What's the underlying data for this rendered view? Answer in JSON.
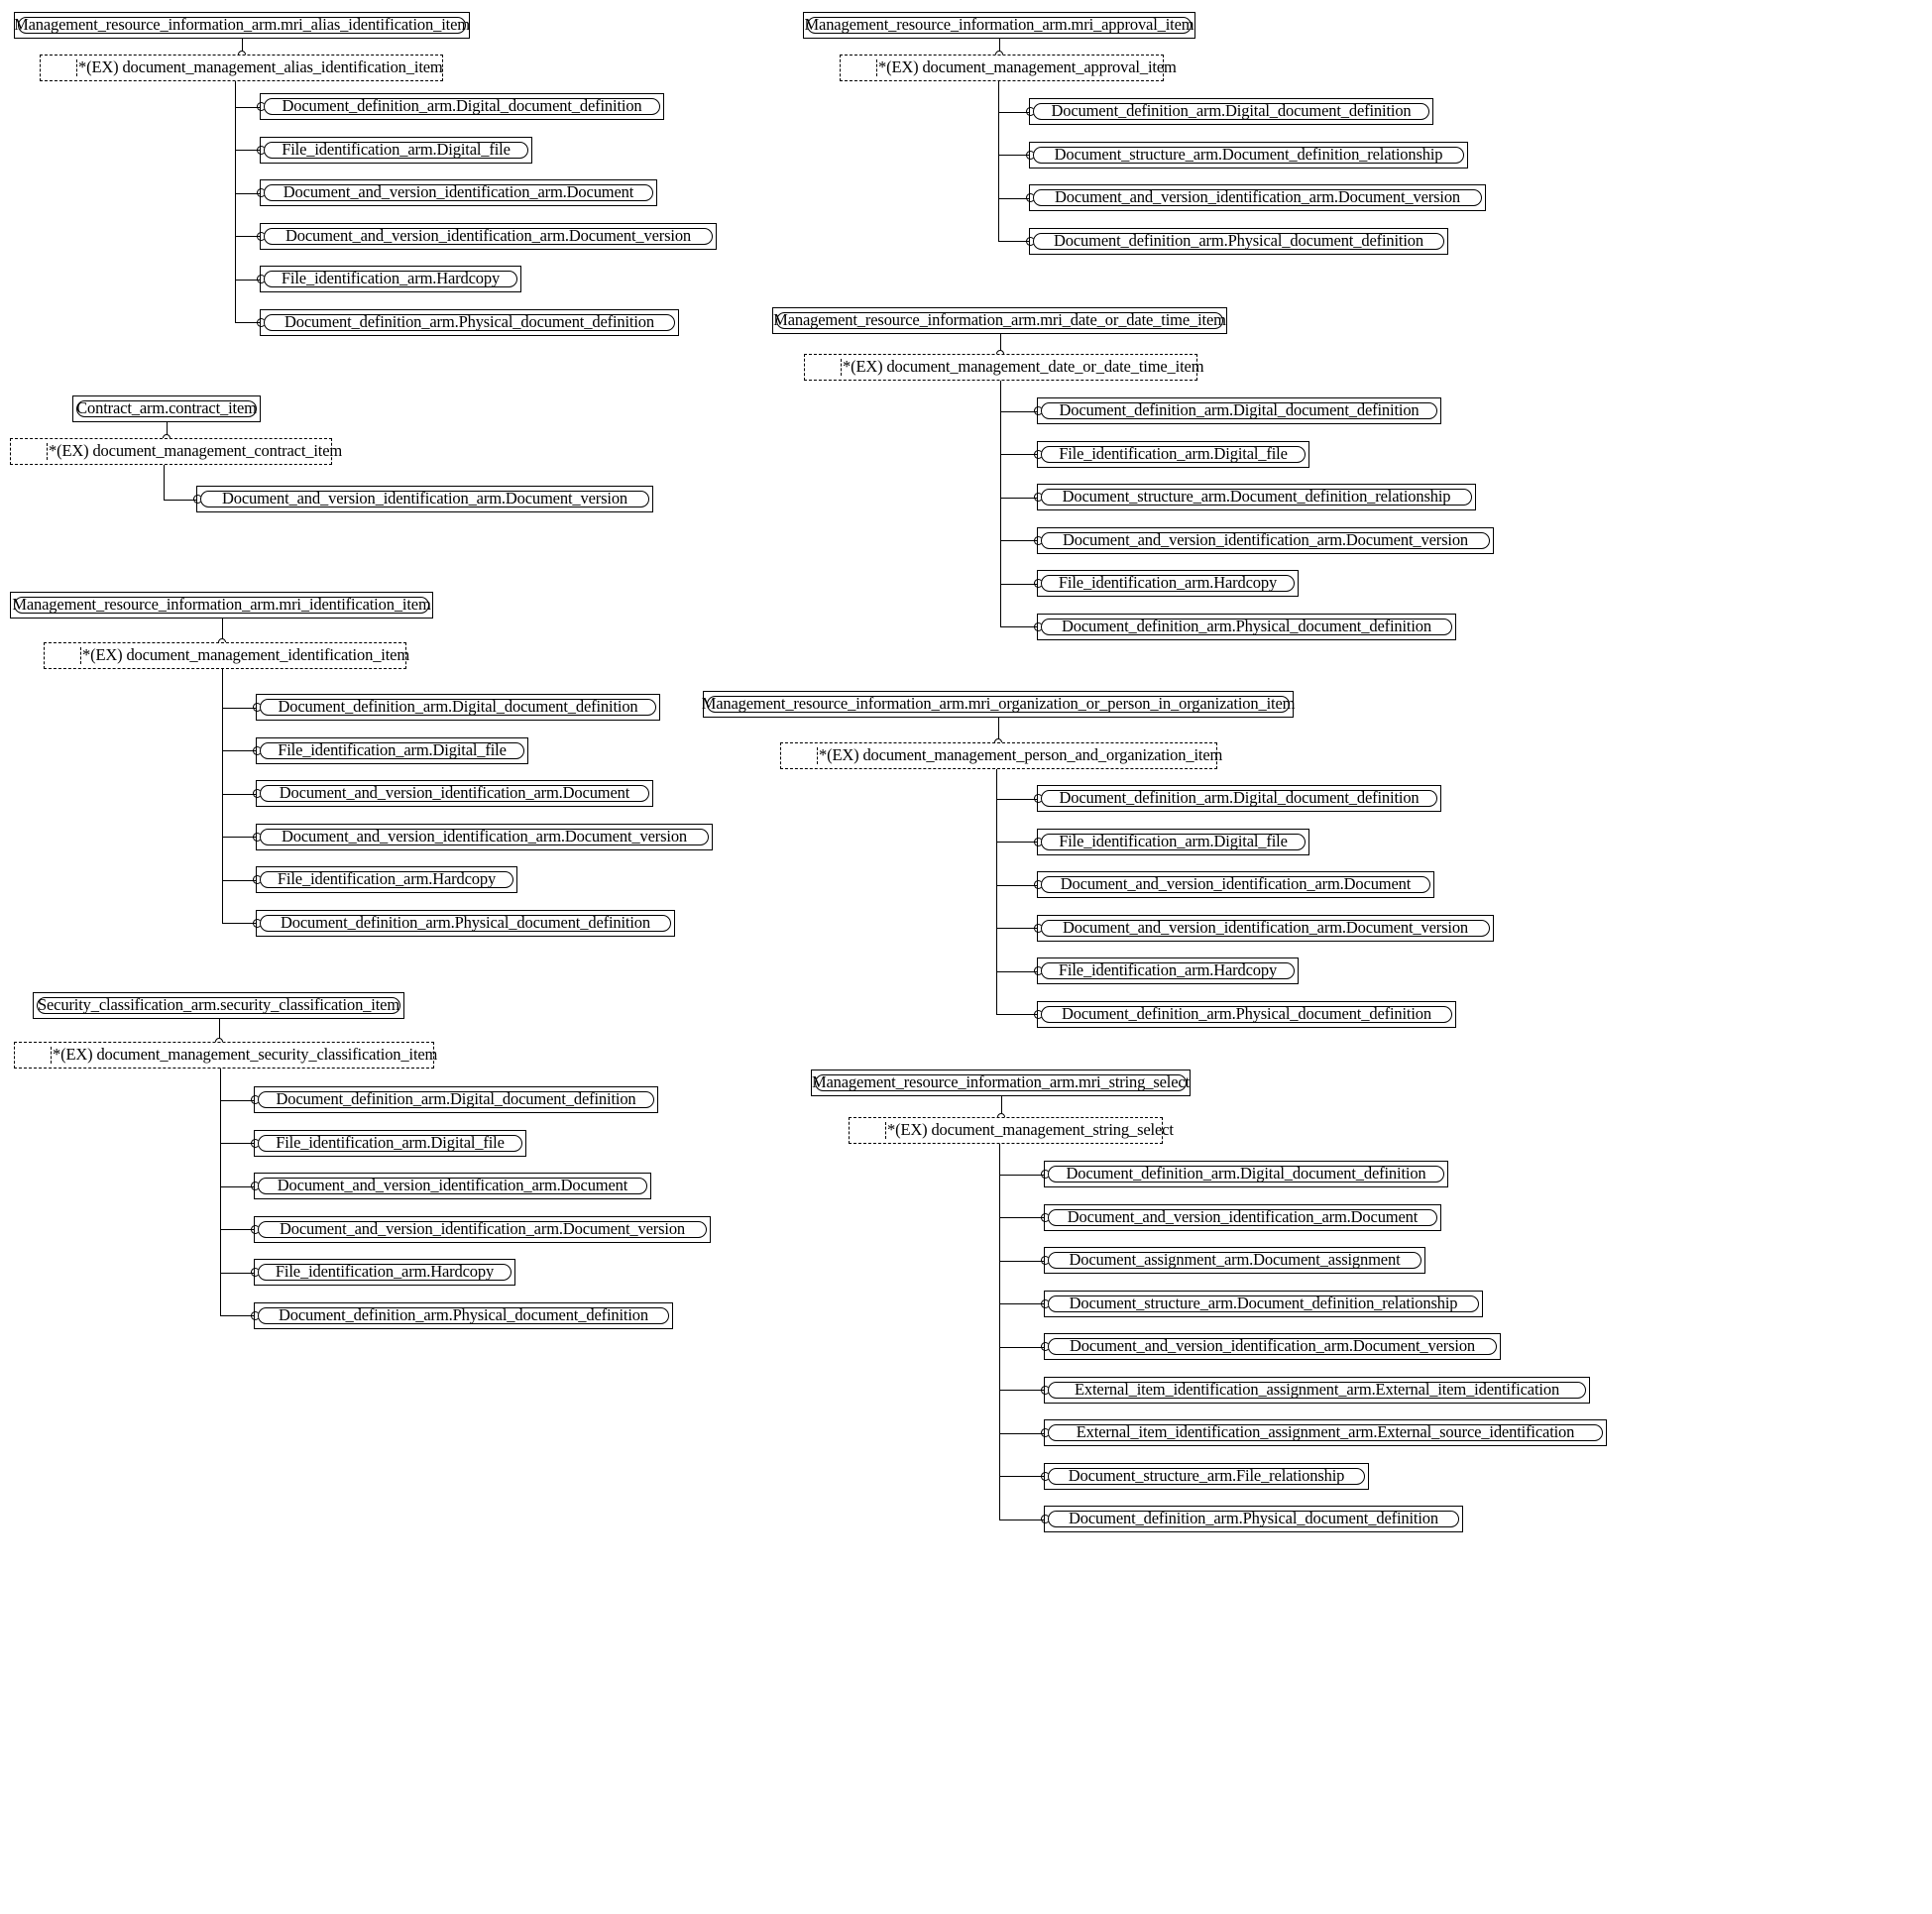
{
  "diagram": {
    "title": "Document management mapping diagram",
    "type": "express-g-mapping",
    "legend": {
      "ex_prefix": "*(EX)",
      "connector_marker": "open-circle"
    },
    "groups": [
      {
        "id": "alias",
        "root": "Management_resource_information_arm.mri_alias_identification_item",
        "mapping": "*(EX) document_management_alias_identification_item",
        "children": [
          "Document_definition_arm.Digital_document_definition",
          "File_identification_arm.Digital_file",
          "Document_and_version_identification_arm.Document",
          "Document_and_version_identification_arm.Document_version",
          "File_identification_arm.Hardcopy",
          "Document_definition_arm.Physical_document_definition"
        ]
      },
      {
        "id": "contract",
        "root": "Contract_arm.contract_item",
        "mapping": "*(EX) document_management_contract_item",
        "children": [
          "Document_and_version_identification_arm.Document_version"
        ]
      },
      {
        "id": "identification",
        "root": "Management_resource_information_arm.mri_identification_item",
        "mapping": "*(EX) document_management_identification_item",
        "children": [
          "Document_definition_arm.Digital_document_definition",
          "File_identification_arm.Digital_file",
          "Document_and_version_identification_arm.Document",
          "Document_and_version_identification_arm.Document_version",
          "File_identification_arm.Hardcopy",
          "Document_definition_arm.Physical_document_definition"
        ]
      },
      {
        "id": "security",
        "root": "Security_classification_arm.security_classification_item",
        "mapping": "*(EX) document_management_security_classification_item",
        "children": [
          "Document_definition_arm.Digital_document_definition",
          "File_identification_arm.Digital_file",
          "Document_and_version_identification_arm.Document",
          "Document_and_version_identification_arm.Document_version",
          "File_identification_arm.Hardcopy",
          "Document_definition_arm.Physical_document_definition"
        ]
      },
      {
        "id": "approval",
        "root": "Management_resource_information_arm.mri_approval_item",
        "mapping": "*(EX) document_management_approval_item",
        "children": [
          "Document_definition_arm.Digital_document_definition",
          "Document_structure_arm.Document_definition_relationship",
          "Document_and_version_identification_arm.Document_version",
          "Document_definition_arm.Physical_document_definition"
        ]
      },
      {
        "id": "date",
        "root": "Management_resource_information_arm.mri_date_or_date_time_item",
        "mapping": "*(EX) document_management_date_or_date_time_item",
        "children": [
          "Document_definition_arm.Digital_document_definition",
          "File_identification_arm.Digital_file",
          "Document_structure_arm.Document_definition_relationship",
          "Document_and_version_identification_arm.Document_version",
          "File_identification_arm.Hardcopy",
          "Document_definition_arm.Physical_document_definition"
        ]
      },
      {
        "id": "organization",
        "root": "Management_resource_information_arm.mri_organization_or_person_in_organization_item",
        "mapping": "*(EX) document_management_person_and_organization_item",
        "children": [
          "Document_definition_arm.Digital_document_definition",
          "File_identification_arm.Digital_file",
          "Document_and_version_identification_arm.Document",
          "Document_and_version_identification_arm.Document_version",
          "File_identification_arm.Hardcopy",
          "Document_definition_arm.Physical_document_definition"
        ]
      },
      {
        "id": "string_select",
        "root": "Management_resource_information_arm.mri_string_select",
        "mapping": "*(EX) document_management_string_select",
        "children": [
          "Document_definition_arm.Digital_document_definition",
          "Document_and_version_identification_arm.Document",
          "Document_assignment_arm.Document_assignment",
          "Document_structure_arm.Document_definition_relationship",
          "Document_and_version_identification_arm.Document_version",
          "External_item_identification_assignment_arm.External_item_identification",
          "External_item_identification_assignment_arm.External_source_identification",
          "Document_structure_arm.File_relationship",
          "Document_definition_arm.Physical_document_definition"
        ]
      }
    ]
  },
  "layout": {
    "groups": [
      {
        "id": "alias",
        "rootX": 14,
        "rootY": 12,
        "rootW": 460,
        "mapX": 40,
        "mapY": 55,
        "mapW": 407,
        "trunkX": 237,
        "childX": 262,
        "childY0": 94,
        "childStep": 43.5
      },
      {
        "id": "contract",
        "rootX": 73,
        "rootY": 399,
        "rootW": 190,
        "mapX": 10,
        "mapY": 442,
        "mapW": 325,
        "trunkX": 165,
        "childX": 198,
        "childY0": 490,
        "childStep": 43.5
      },
      {
        "id": "identification",
        "rootX": 10,
        "rootY": 597,
        "rootW": 427,
        "mapX": 44,
        "mapY": 648,
        "mapW": 366,
        "trunkX": 224,
        "childX": 258,
        "childY0": 700,
        "childStep": 43.5
      },
      {
        "id": "security",
        "rootX": 33,
        "rootY": 1001,
        "rootW": 375,
        "mapX": 14,
        "mapY": 1051,
        "mapW": 424,
        "trunkX": 222,
        "childX": 256,
        "childY0": 1096,
        "childStep": 43.5
      },
      {
        "id": "approval",
        "rootX": 810,
        "rootY": 12,
        "rootW": 396,
        "mapX": 847,
        "mapY": 55,
        "mapW": 327,
        "trunkX": 1007,
        "childX": 1038,
        "childY0": 99,
        "childStep": 43.5
      },
      {
        "id": "date",
        "rootX": 779,
        "rootY": 310,
        "rootW": 459,
        "mapX": 811,
        "mapY": 357,
        "mapW": 397,
        "trunkX": 1009,
        "childX": 1046,
        "childY0": 401,
        "childStep": 43.5
      },
      {
        "id": "organization",
        "rootX": 709,
        "rootY": 697,
        "rootW": 596,
        "mapX": 787,
        "mapY": 749,
        "mapW": 441,
        "trunkX": 1005,
        "childX": 1046,
        "childY0": 792,
        "childStep": 43.5
      },
      {
        "id": "string_select",
        "rootX": 818,
        "rootY": 1079,
        "rootW": 383,
        "mapX": 856,
        "mapY": 1127,
        "mapW": 317,
        "trunkX": 1008,
        "childX": 1053,
        "childY0": 1171,
        "childStep": 43.5
      }
    ],
    "boxHeight": 27,
    "mapHeight": 27
  }
}
